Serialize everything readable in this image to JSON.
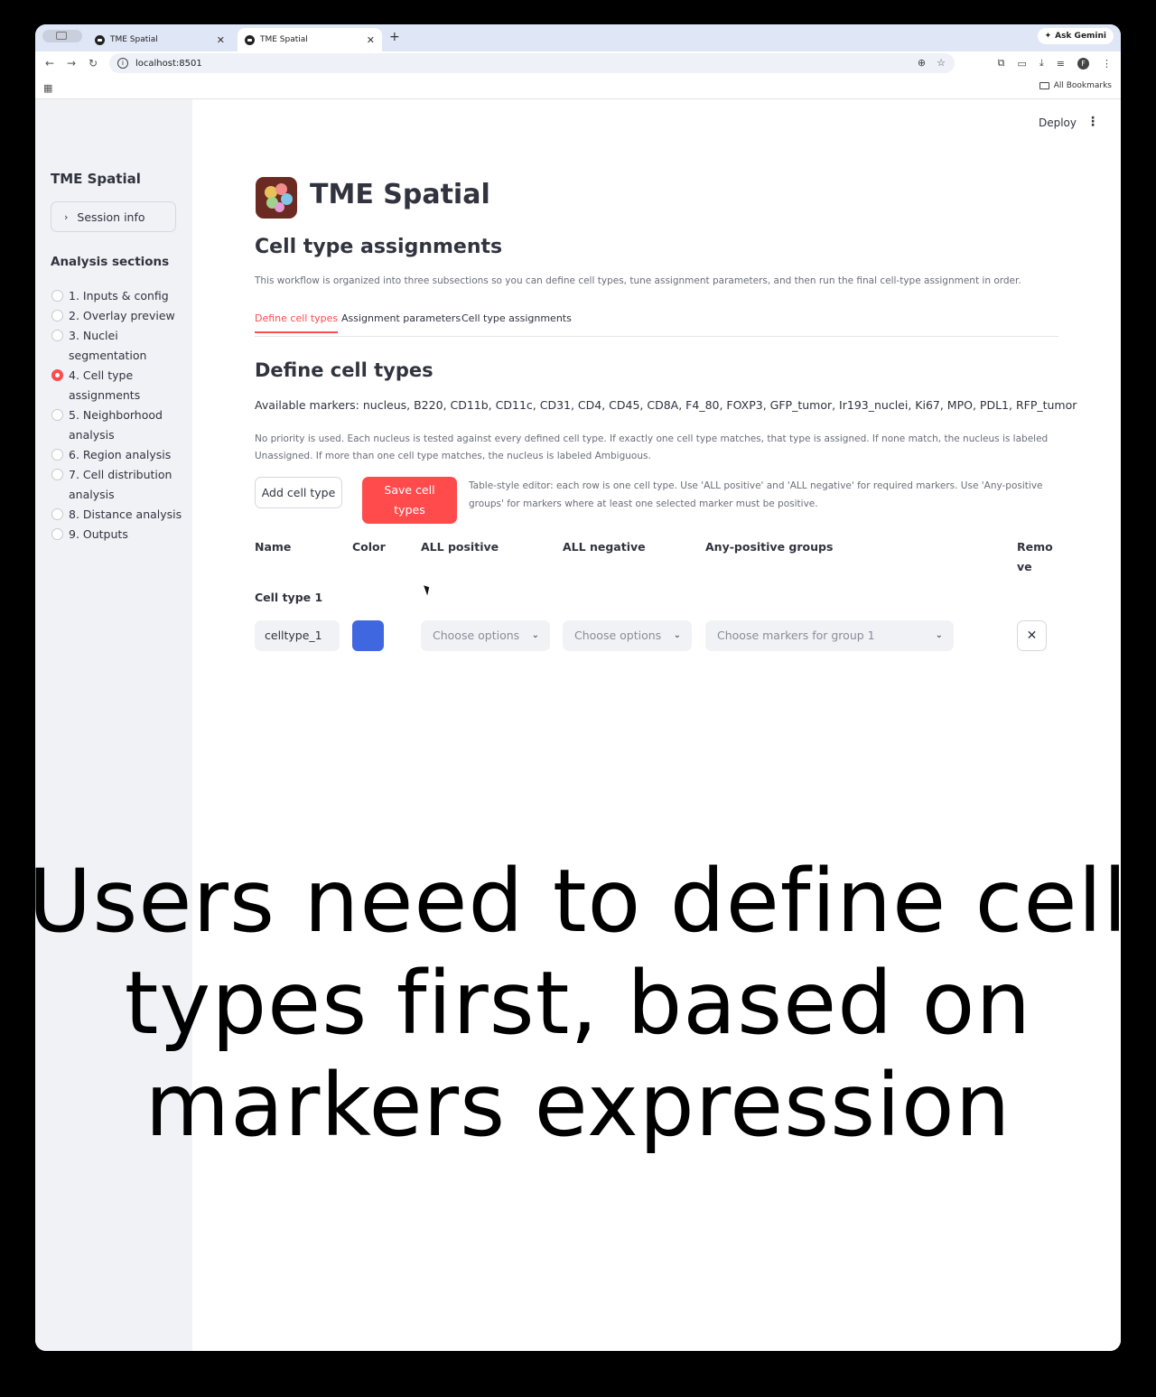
{
  "browser": {
    "tabs": [
      {
        "title": "TME Spatial"
      },
      {
        "title": "TME Spatial"
      }
    ],
    "ask_gemini": "Ask Gemini",
    "url": "localhost:8501",
    "profile_initial": "F",
    "all_bookmarks": "All Bookmarks"
  },
  "sidebar": {
    "app_title": "TME Spatial",
    "session_info": "Session info",
    "section_heading": "Analysis sections",
    "items": [
      {
        "label": "1. Inputs & config",
        "selected": false
      },
      {
        "label": "2. Overlay preview",
        "selected": false
      },
      {
        "label": "3. Nuclei segmentation",
        "selected": false
      },
      {
        "label": "4. Cell type assignments",
        "selected": true
      },
      {
        "label": "5. Neighborhood analysis",
        "selected": false
      },
      {
        "label": "6. Region analysis",
        "selected": false
      },
      {
        "label": "7. Cell distribution analysis",
        "selected": false
      },
      {
        "label": "8. Distance analysis",
        "selected": false
      },
      {
        "label": "9. Outputs",
        "selected": false
      }
    ]
  },
  "header": {
    "deploy": "Deploy",
    "menu_icon": "kebab-menu-icon"
  },
  "main": {
    "app_title": "TME Spatial",
    "page_title": "Cell type assignments",
    "description": "This workflow is organized into three subsections so you can define cell types, tune assignment parameters, and then run the final cell-type assignment in order.",
    "tabs": [
      {
        "label": "Define cell types",
        "active": true
      },
      {
        "label": "Assignment parameters",
        "active": false
      },
      {
        "label": "Cell type assignments",
        "active": false
      }
    ],
    "section_title": "Define cell types",
    "available_markers": "Available markers: nucleus, B220, CD11b, CD11c, CD31, CD4, CD45, CD8A, F4_80, FOXP3, GFP_tumor, Ir193_nuclei, Ki67, MPO, PDL1, RFP_tumor",
    "rule_text": "No priority is used. Each nucleus is tested against every defined cell type. If exactly one cell type matches, that type is assigned. If none match, the nucleus is labeled Unassigned. If more than one cell type matches, the nucleus is labeled Ambiguous.",
    "add_button": "Add cell type",
    "save_button": "Save cell types",
    "editor_note": "Table-style editor: each row is one cell type. Use 'ALL positive' and 'ALL negative' for required markers. Use 'Any-positive groups' for markers where at least one selected marker must be positive.",
    "columns": {
      "name": "Name",
      "color": "Color",
      "all_positive": "ALL positive",
      "all_negative": "ALL negative",
      "any_positive": "Any-positive groups",
      "remove": "Remove"
    },
    "rows": [
      {
        "label": "Cell type 1",
        "name": "celltype_1",
        "color": "#3f67e0",
        "all_positive_placeholder": "Choose options",
        "all_negative_placeholder": "Choose options",
        "any_positive_placeholder": "Choose markers for group 1"
      }
    ]
  },
  "caption": "Users need to define cell types first, based on markers expression",
  "colors": {
    "accent": "#ff4b4b",
    "sidebar_bg": "#f0f2f6",
    "text": "#31333f"
  }
}
